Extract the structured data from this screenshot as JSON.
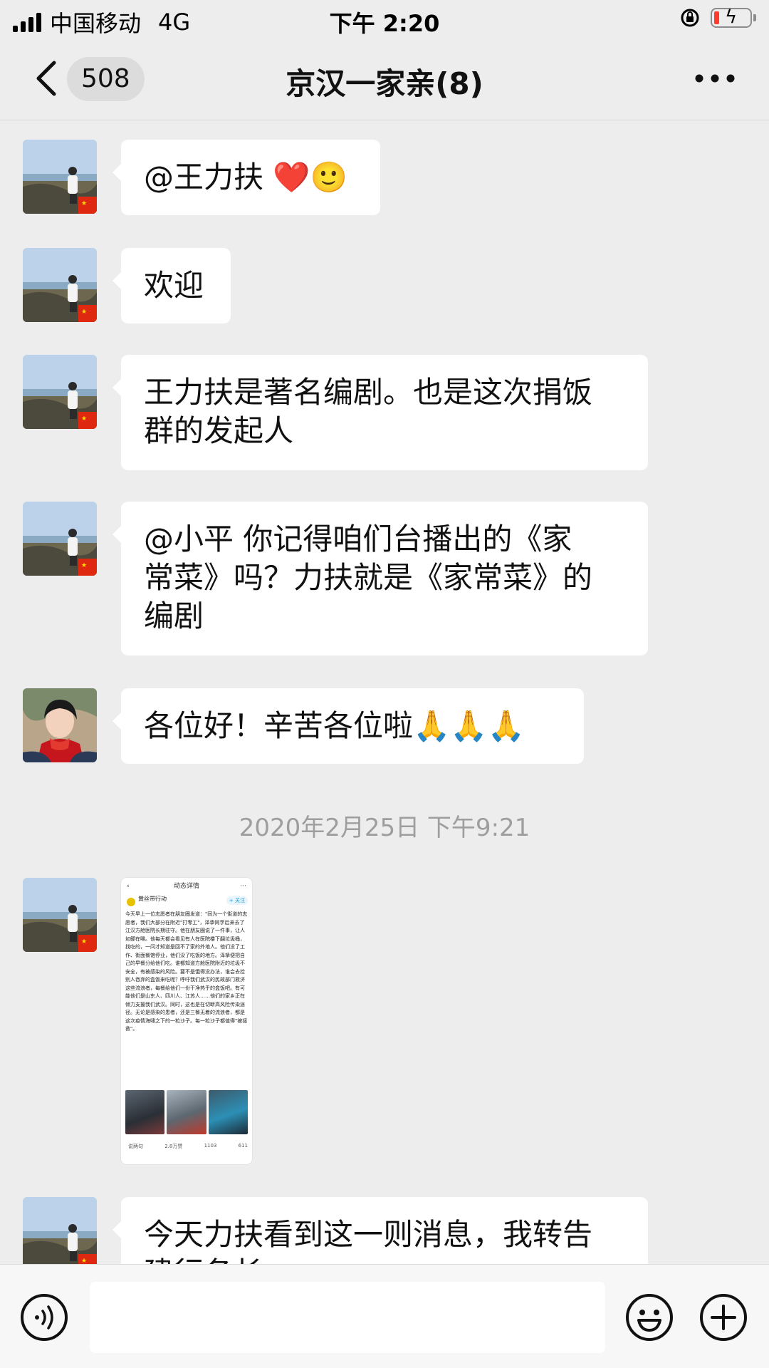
{
  "status_bar": {
    "carrier": "中国移动",
    "network": "4G",
    "time": "下午 2:20"
  },
  "nav": {
    "unread_count": "508",
    "title": "京汉一家亲(8)",
    "icons": [
      "back-chevron-icon",
      "more-dots-icon"
    ]
  },
  "messages": [
    {
      "sender": "avatar-seaside",
      "lines": [
        "@王力扶 ❤️🙂"
      ]
    },
    {
      "sender": "avatar-seaside",
      "lines": [
        "欢迎"
      ]
    },
    {
      "sender": "avatar-seaside",
      "lines": [
        "王力扶是著名编剧。也是这次捐饭",
        "群的发起人"
      ]
    },
    {
      "sender": "avatar-seaside",
      "lines": [
        "@小平 你记得咱们台播出的《家",
        "常菜》吗？力扶就是《家常菜》的",
        "编剧"
      ]
    },
    {
      "sender": "avatar-woman-red-scarf",
      "lines": [
        "各位好！辛苦各位啦🙏🙏🙏"
      ]
    },
    {
      "sender": "avatar-seaside",
      "lines": [
        "今天力扶看到这一则消息，我转告",
        "建行各长..."
      ]
    }
  ],
  "timestamp": "2020年2月25日 下午9:21",
  "image_message": {
    "header": "动态详情",
    "author": "黄丝带行动",
    "follow": "+ 关注",
    "body": "今天早上一位志愿者在朋友圈发道：\"同为一个街道的志愿者，我们大部分在附近\"打零工\"，泽挚同学后来去了江汉方舱医院长期驻守。他在朋友圈说了一件事，让人如鲠在喉。他每天都会看见有人在医院楼下翻垃圾桶，找吃的，一问才知道是回不了家的外地人。他们没了工作、街面餐馆停业，他们没了吃饭的地方。泽挚便把自己的早餐分给他们吃。谁都知道方舱医院附近的垃圾不安全，有被感染的风险。要不是饿得没办法，谁会去捡别人吞弃的盒饭来吃呢？呼吁我们武汉的民政部门救济这些流浪者，每餐给他们一份干净热乎的盒饭吧。有可能他们是山东人、四川人、江苏人……他们的家乡正在倾力支援我们武汉。同时，这也是在切断高风险传染途径。无论是感染的患者，还是三餐无着的流浪者，都是这次疫情海啸之下的一粒沙子。每一粒沙子都值得\"被拯救\"。",
    "footer": [
      "说两句",
      "2.8万赞",
      "1103",
      "611"
    ]
  },
  "input_bar": {
    "placeholder": "",
    "icons": [
      "voice-icon",
      "emoji-icon",
      "plus-icon"
    ]
  },
  "colors": {
    "background": "#ededed",
    "bubble": "#ffffff",
    "timestamp": "#9e9e9e",
    "battery_low": "#ff3b30"
  }
}
